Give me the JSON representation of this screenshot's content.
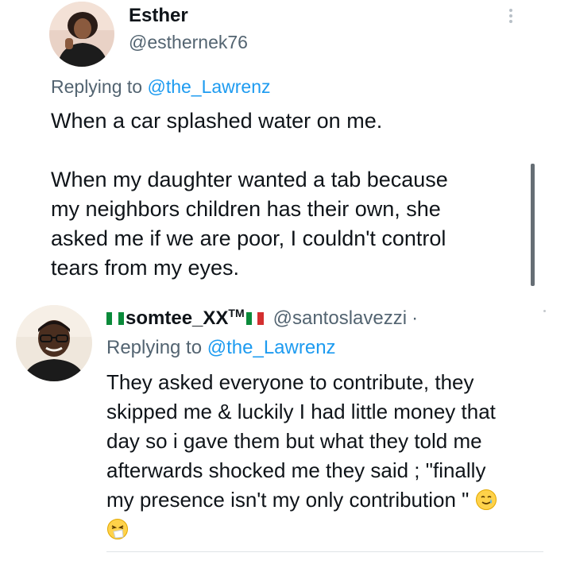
{
  "tweet": {
    "author_name": "Esther",
    "author_handle": "@esthernek76",
    "replying_prefix": "Replying to ",
    "replying_to": "@the_Lawrenz",
    "text_line_1": "When a car splashed water on me.",
    "text_lines_2": [
      "When my daughter wanted a tab because",
      "my neighbors children has their own, she",
      "asked me if we are poor, I couldn't control",
      "tears from my eyes."
    ],
    "more_icon": "more-vertical-icon"
  },
  "reply": {
    "author_name": "somtee_XX",
    "author_name_mark": "TM",
    "author_handle": "@santoslavezzi",
    "separator": "·",
    "replying_prefix": "Replying to ",
    "replying_to": "@the_Lawrenz",
    "text_lines": [
      "They asked everyone to contribute, they",
      "skipped me & luckily I had little money that",
      "day so i gave them but what they told me",
      "afterwards shocked me they said ; \"finally",
      "my presence isn't my only contribution \""
    ],
    "emojis": [
      "smiling-face-with-tear-icon",
      "sneezing-face-icon"
    ],
    "flag_colors": [
      "#0a8a3a",
      "#ffffff",
      "#0a8a3a"
    ],
    "flag2_colors": [
      "#0a8a3a",
      "#ffffff",
      "#d32f2f"
    ]
  },
  "colors": {
    "text": "#0f1419",
    "secondary": "#536471",
    "link": "#1d9bf0"
  }
}
